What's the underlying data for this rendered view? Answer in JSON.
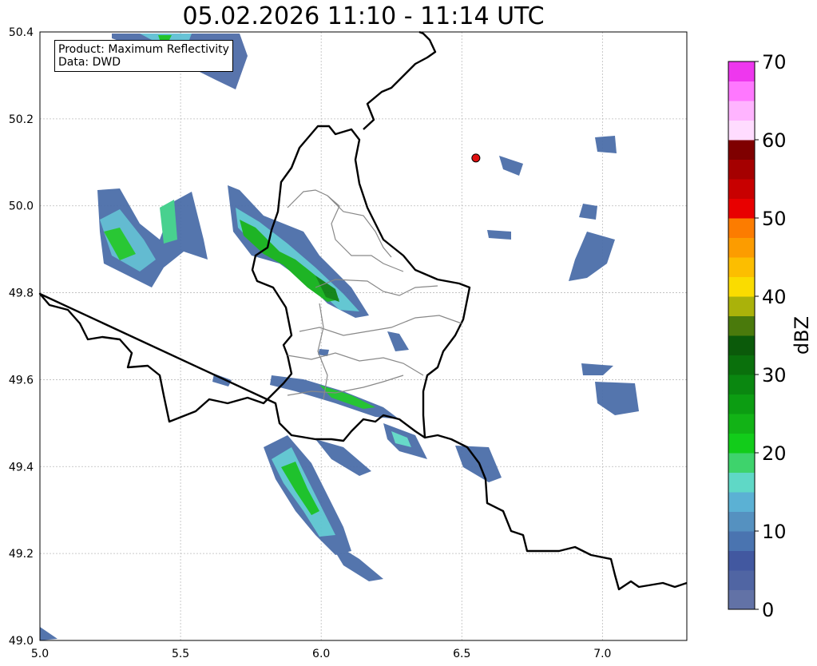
{
  "title": "05.02.2026 11:10 - 11:14 UTC",
  "info_box": {
    "product": "Product: Maximum Reflectivity",
    "data": "Data: DWD"
  },
  "map": {
    "lon_range": [
      5.0,
      7.3
    ],
    "lat_range": [
      49.0,
      50.4
    ],
    "x_ticks": [
      "5.0",
      "5.5",
      "6.0",
      "6.5",
      "7.0"
    ],
    "y_ticks": [
      "49.0",
      "49.2",
      "49.4",
      "49.6",
      "49.8",
      "50.0",
      "50.2",
      "50.4"
    ],
    "grid": "dotted",
    "marker": {
      "lon": 6.55,
      "lat": 50.11,
      "color": "#e01010"
    }
  },
  "colorbar": {
    "label": "dBZ",
    "tick_labels": [
      "0",
      "10",
      "20",
      "30",
      "40",
      "50",
      "60",
      "70"
    ],
    "colors": [
      "#6272a6",
      "#5065a3",
      "#4258a0",
      "#4a74b0",
      "#5591c0",
      "#5bb1d4",
      "#5fd8c6",
      "#3ed36c",
      "#12cc1a",
      "#12b316",
      "#0c9d12",
      "#0a8710",
      "#0a700c",
      "#0b5a0a",
      "#4a7a0c",
      "#aab20a",
      "#fadc00",
      "#fcbe00",
      "#fc9c00",
      "#fc7c00",
      "#e80000",
      "#c80000",
      "#a50000",
      "#7f0000",
      "#ffdcff",
      "#ffb4ff",
      "#ff78ff",
      "#ee37ee"
    ]
  }
}
